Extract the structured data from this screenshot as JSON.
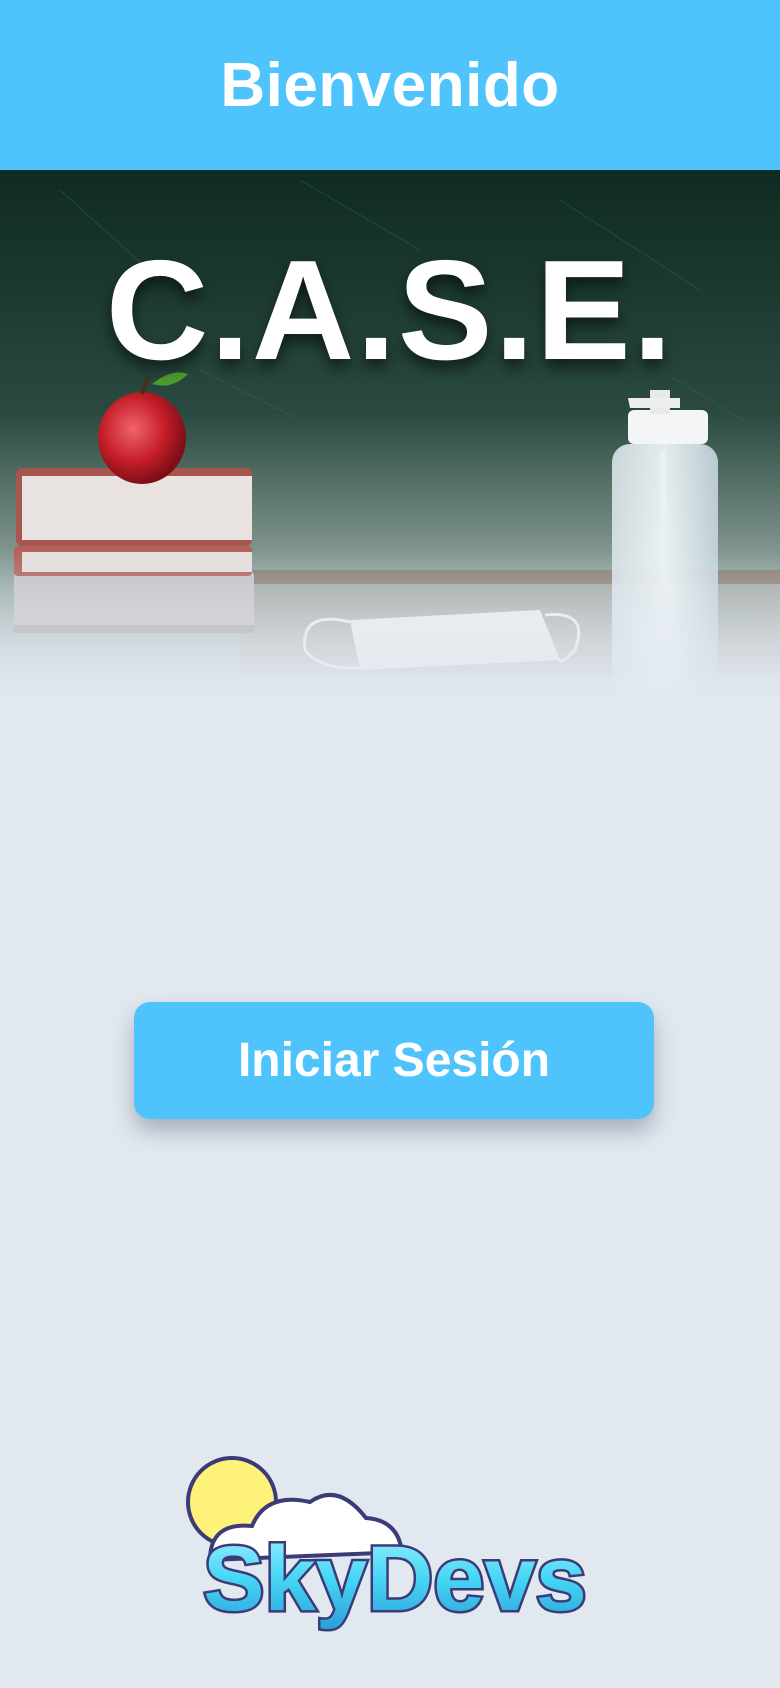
{
  "header": {
    "title": "Bienvenido"
  },
  "hero": {
    "title": "C.A.S.E."
  },
  "login": {
    "label": "Iniciar Sesión"
  },
  "logo": {
    "text": "SkyDevs"
  },
  "colors": {
    "accent": "#4fc3fc",
    "background": "#e1e8f0",
    "chalkboard": "#1f3a30"
  }
}
